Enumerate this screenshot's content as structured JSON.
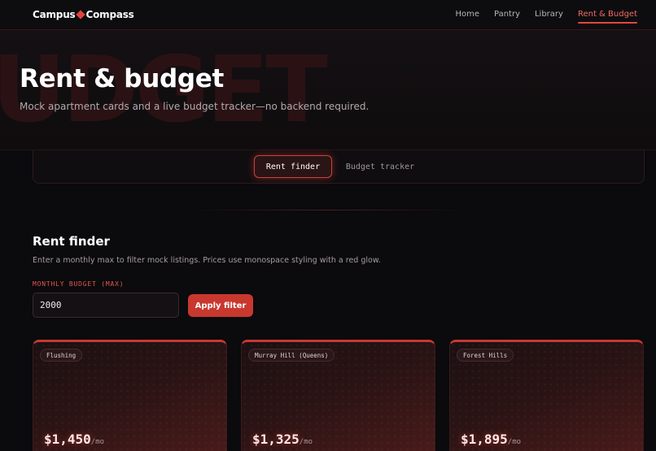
{
  "brand": {
    "name_left": "Campus",
    "name_right": "Compass",
    "accent": "#e0433a"
  },
  "nav": {
    "links": [
      "Home",
      "Pantry",
      "Library",
      "Rent & Budget"
    ],
    "active": "Rent & Budget"
  },
  "hero": {
    "bg_word": "UDGET",
    "title": "Rent & budget",
    "subtitle": "Mock apartment cards and a live budget tracker—no backend required."
  },
  "tabs": {
    "active_label": "Rent finder",
    "inactive_label": "Budget tracker"
  },
  "rent_finder": {
    "title": "Rent finder",
    "description": "Enter a monthly max to filter mock listings. Prices use monospace styling with a red glow.",
    "field_label": "MONTHLY BUDGET (MAX)",
    "budget_value": "2000",
    "apply_label": "Apply filter"
  },
  "listings": [
    {
      "neighborhood": "Flushing",
      "price": "$1,450",
      "unit": "/mo"
    },
    {
      "neighborhood": "Murray Hill (Queens)",
      "price": "$1,325",
      "unit": "/mo"
    },
    {
      "neighborhood": "Forest Hills",
      "price": "$1,895",
      "unit": "/mo"
    }
  ],
  "colors": {
    "background": "#0b0a0d",
    "accent_red": "#c8382f",
    "active_link": "#ef6a63"
  }
}
